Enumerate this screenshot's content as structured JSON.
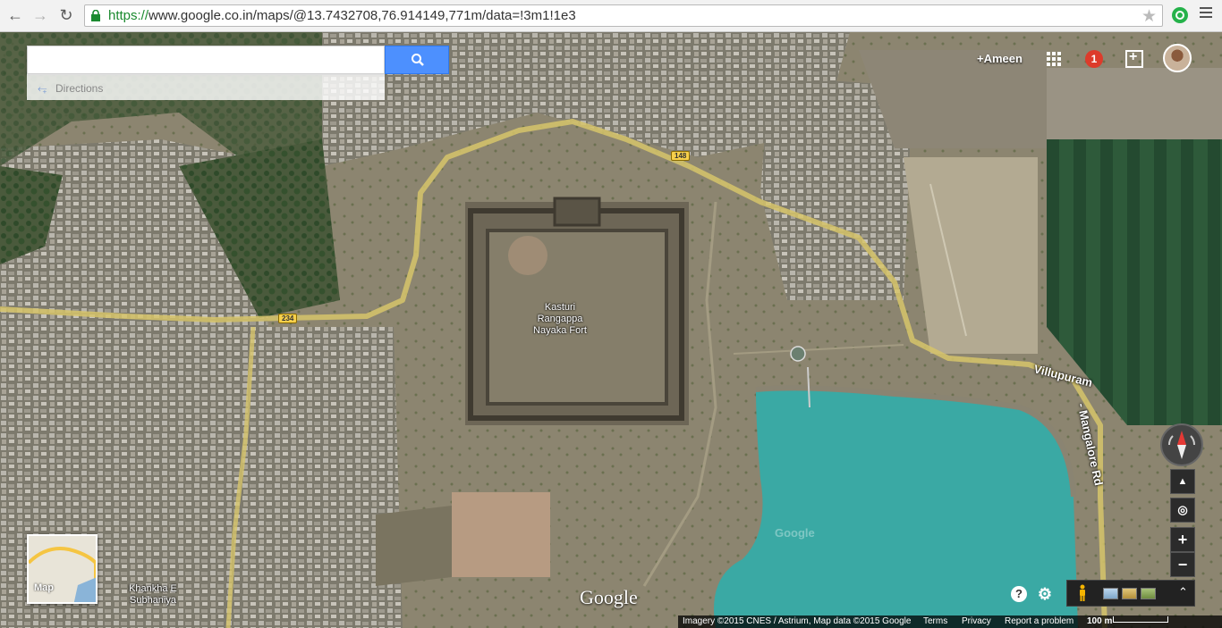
{
  "browser": {
    "url_protocol": "https://",
    "url_rest": "www.google.co.in/maps/@13.7432708,76.914149,771m/data=!3m1!1e3"
  },
  "search": {
    "value": "",
    "placeholder": ""
  },
  "directions_label": "Directions",
  "account": {
    "name": "+Ameen",
    "notification_count": "1"
  },
  "map": {
    "place_label": [
      "Kasturi",
      "Rangappa",
      "Nayaka Fort"
    ],
    "locality_label": [
      "Khankha E",
      "Subhaniya"
    ],
    "road_shields": {
      "shield_a": "234",
      "shield_b": "148"
    },
    "road_name_a": "Villupuram",
    "road_name_b": "- Mangalore Rd",
    "minimap_label": "Map",
    "logo": "Google",
    "watermark": "Google"
  },
  "footer": {
    "imagery": "Imagery ©2015 CNES / Astrium, Map data ©2015 Google",
    "terms": "Terms",
    "privacy": "Privacy",
    "report": "Report a problem",
    "scale": "100 m"
  },
  "colors": {
    "search_button": "#4d90fe",
    "notification": "#dd3b2b",
    "road": "#d6c46a",
    "water": "#3aa9a4"
  }
}
